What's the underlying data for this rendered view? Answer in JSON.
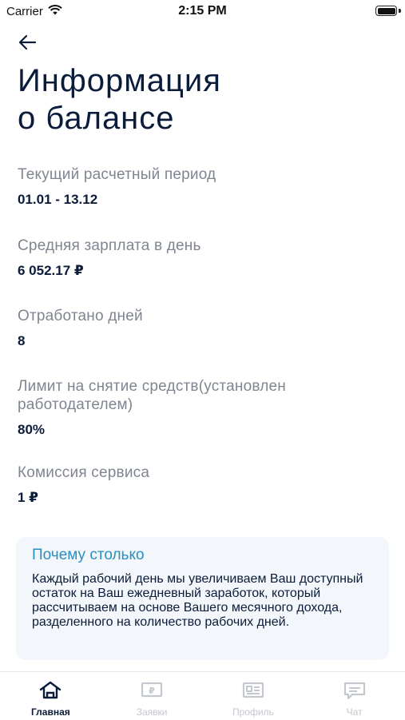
{
  "status_bar": {
    "carrier": "Carrier",
    "time": "2:15 PM"
  },
  "header": {
    "title_line1": "Информация",
    "title_line2": "о балансе"
  },
  "info": [
    {
      "label": "Текущий расчетный период",
      "value": "01.01 - 13.12"
    },
    {
      "label": "Средняя зарплата в день",
      "value": "6 052.17 ₽"
    },
    {
      "label": "Отработано дней",
      "value": "8"
    },
    {
      "label": "Лимит на снятие средств(установлен работодателем)",
      "value": "80%"
    },
    {
      "label": "Комиссия сервиса",
      "value": "1 ₽"
    }
  ],
  "why_card": {
    "title": "Почему столько",
    "text": "Каждый рабочий день мы увеличиваем Ваш доступный остаток на Ваш ежедневный заработок, который рассчитываем на основе Вашего месячного дохода, разделенного на количество рабочих дней."
  },
  "tabs": [
    {
      "label": "Главная",
      "icon": "home-icon",
      "active": true
    },
    {
      "label": "Заявки",
      "icon": "requests-icon",
      "active": false
    },
    {
      "label": "Профиль",
      "icon": "profile-icon",
      "active": false
    },
    {
      "label": "Чат",
      "icon": "chat-icon",
      "active": false
    }
  ],
  "colors": {
    "primary_text": "#0b1b3a",
    "secondary_text": "#7f8591",
    "accent": "#2a8fc0",
    "card_bg": "#f3f7fb",
    "inactive_tab": "#c4c7cd"
  }
}
